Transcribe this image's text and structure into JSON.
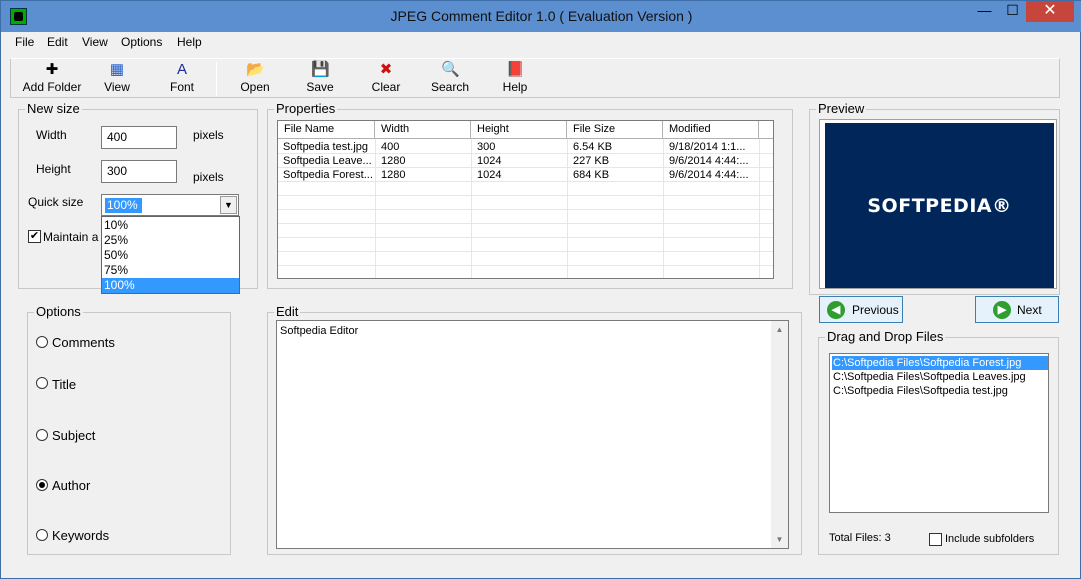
{
  "window": {
    "title": "JPEG Comment Editor 1.0 ( Evaluation Version )",
    "min": "—",
    "max": "☐",
    "close": "✕"
  },
  "menu": [
    "File",
    "Edit",
    "View",
    "Options",
    "Help"
  ],
  "toolbar": [
    {
      "label": "Add Folder",
      "icon": "plus-icon",
      "glyph": "✚",
      "color": "#000000"
    },
    {
      "label": "View",
      "icon": "view-icon",
      "glyph": "▦",
      "color": "#1a55c8"
    },
    {
      "label": "Font",
      "icon": "font-icon",
      "glyph": "A",
      "color": "#1a2a9a"
    },
    {
      "label": "Open",
      "icon": "folder-open-icon",
      "glyph": "📂",
      "color": "#c89a1a"
    },
    {
      "label": "Save",
      "icon": "floppy-icon",
      "glyph": "💾",
      "color": "#000000"
    },
    {
      "label": "Clear",
      "icon": "clear-x-icon",
      "glyph": "✖",
      "color": "#d01010"
    },
    {
      "label": "Search",
      "icon": "search-icon",
      "glyph": "🔍",
      "color": "#2a7a2a"
    },
    {
      "label": "Help",
      "icon": "help-book-icon",
      "glyph": "📕",
      "color": "#8a2a6a"
    }
  ],
  "new_size": {
    "title": "New size",
    "width_label": "Width",
    "width_value": "400",
    "width_unit": "pixels",
    "height_label": "Height",
    "height_value": "300",
    "height_unit": "pixels",
    "quick_label": "Quick size",
    "quick_value": "100%",
    "quick_options": [
      "10%",
      "25%",
      "50%",
      "75%",
      "100%"
    ],
    "maintain_label": "Maintain a"
  },
  "properties": {
    "title": "Properties",
    "columns": [
      "File Name",
      "Width",
      "Height",
      "File Size",
      "Modified"
    ],
    "rows": [
      [
        "Softpedia test.jpg",
        "400",
        "300",
        "6.54 KB",
        "9/18/2014 1:1..."
      ],
      [
        "Softpedia Leave...",
        "1280",
        "1024",
        "227 KB",
        "9/6/2014 4:44:..."
      ],
      [
        "Softpedia Forest....",
        "1280",
        "1024",
        "684 KB",
        "9/6/2014 4:44:..."
      ]
    ]
  },
  "preview": {
    "title": "Preview",
    "logo_text": "SOFTPEDIA®",
    "prev_label": "Previous",
    "next_label": "Next"
  },
  "options": {
    "title": "Options",
    "items": [
      "Comments",
      "Title",
      "Subject",
      "Author",
      "Keywords"
    ],
    "selected": "Author"
  },
  "edit": {
    "title": "Edit",
    "text": "Softpedia Editor"
  },
  "dnd": {
    "title": "Drag and Drop Files",
    "files": [
      "C:\\Softpedia Files\\Softpedia Forest.jpg",
      "C:\\Softpedia Files\\Softpedia Leaves.jpg",
      "C:\\Softpedia Files\\Softpedia test.jpg"
    ],
    "total_label": "Total Files: 3",
    "include_label": "Include subfolders"
  }
}
